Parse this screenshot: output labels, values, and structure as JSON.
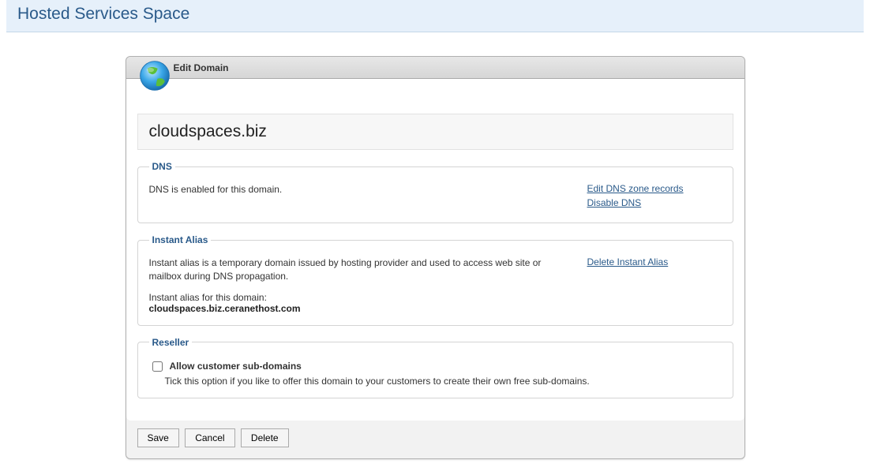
{
  "header": {
    "title": "Hosted Services Space"
  },
  "panel": {
    "title": "Edit Domain",
    "domain": "cloudspaces.biz"
  },
  "dns": {
    "legend": "DNS",
    "status": "DNS is enabled for this domain.",
    "links": {
      "edit": "Edit DNS zone records",
      "disable": "Disable DNS"
    }
  },
  "alias": {
    "legend": "Instant Alias",
    "description": "Instant alias is a temporary domain issued by hosting provider and used to access web site or mailbox during DNS propagation.",
    "label": "Instant alias for this domain:",
    "value": "cloudspaces.biz.ceranethost.com",
    "links": {
      "delete": "Delete Instant Alias"
    }
  },
  "reseller": {
    "legend": "Reseller",
    "checkbox_label": "Allow customer sub-domains",
    "checkbox_desc": "Tick this option if you like to offer this domain to your customers to create their own free sub-domains."
  },
  "buttons": {
    "save": "Save",
    "cancel": "Cancel",
    "delete": "Delete"
  }
}
